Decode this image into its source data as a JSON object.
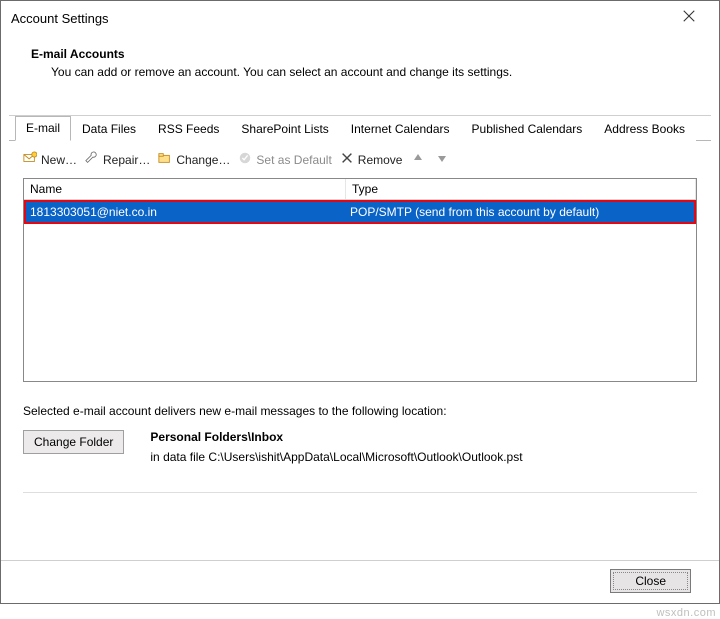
{
  "window": {
    "title": "Account Settings"
  },
  "header": {
    "heading": "E-mail Accounts",
    "subtext": "You can add or remove an account. You can select an account and change its settings."
  },
  "tabs": [
    {
      "label": "E-mail",
      "active": true
    },
    {
      "label": "Data Files"
    },
    {
      "label": "RSS Feeds"
    },
    {
      "label": "SharePoint Lists"
    },
    {
      "label": "Internet Calendars"
    },
    {
      "label": "Published Calendars"
    },
    {
      "label": "Address Books"
    }
  ],
  "toolbar": {
    "new_label": "New…",
    "repair_label": "Repair…",
    "change_label": "Change…",
    "set_default_label": "Set as Default",
    "remove_label": "Remove"
  },
  "list": {
    "columns": {
      "name": "Name",
      "type": "Type"
    },
    "rows": [
      {
        "name": "1813303051@niet.co.in",
        "type": "POP/SMTP (send from this account by default)"
      }
    ]
  },
  "footer": {
    "delivers_text": "Selected e-mail account delivers new e-mail messages to the following location:",
    "change_folder_label": "Change Folder",
    "folder_bold": "Personal Folders\\Inbox",
    "folder_path": "in data file C:\\Users\\ishit\\AppData\\Local\\Microsoft\\Outlook\\Outlook.pst"
  },
  "buttons": {
    "close": "Close"
  },
  "watermark": "wsxdn.com"
}
